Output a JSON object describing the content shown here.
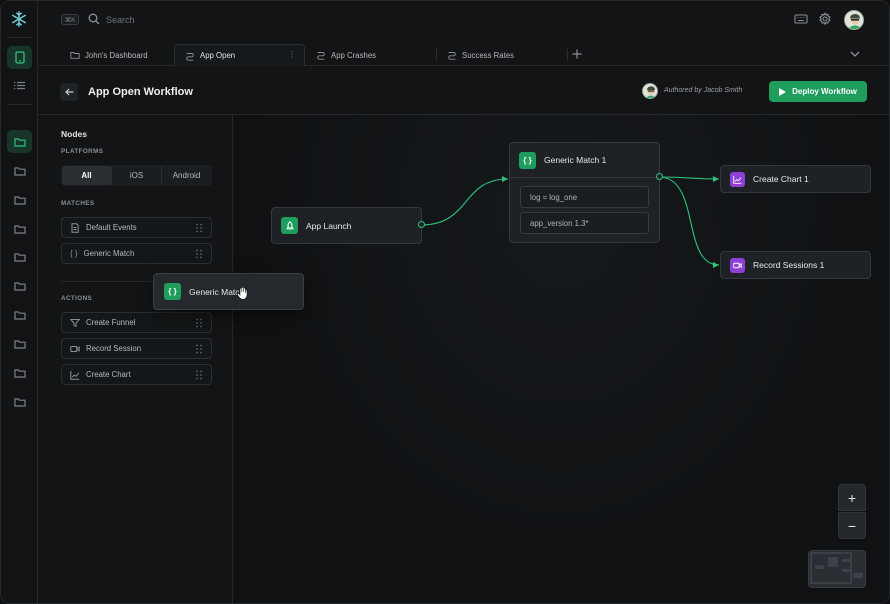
{
  "topbar": {
    "shortcut": "⌘K",
    "search_placeholder": "Search"
  },
  "tabs": [
    {
      "label": "John's Dashboard",
      "icon": "folder-icon"
    },
    {
      "label": "App Open",
      "icon": "workflow-icon",
      "active": true
    },
    {
      "label": "App Crashes",
      "icon": "workflow-icon"
    },
    {
      "label": "Success Rates",
      "icon": "workflow-icon"
    }
  ],
  "header": {
    "title": "App Open Workflow",
    "author": "Authored by Jacob Smith",
    "deploy_label": "Deploy Workflow"
  },
  "panel": {
    "title": "Nodes",
    "platforms_label": "PLATFORMS",
    "platforms": [
      "All",
      "iOS",
      "Android"
    ],
    "selected_platform": "All",
    "matches_label": "MATCHES",
    "matches": [
      "Default Events",
      "Generic Match"
    ],
    "actions_label": "ACTIONS",
    "actions": [
      "Create Funnel",
      "Record Session",
      "Create Chart"
    ]
  },
  "canvas": {
    "drag_node": "Generic Match",
    "nodes": {
      "app_launch": "App Launch",
      "generic_match": "Generic Match 1",
      "conditions": [
        "log = log_one",
        "app_version 1.3*"
      ],
      "create_chart": "Create Chart 1",
      "record_sessions": "Record Sessions 1"
    },
    "zoom_in": "+",
    "zoom_out": "−"
  },
  "colors": {
    "accent": "#1f9d5c",
    "action_badge": "#8e3fd6",
    "background": "#121416"
  }
}
